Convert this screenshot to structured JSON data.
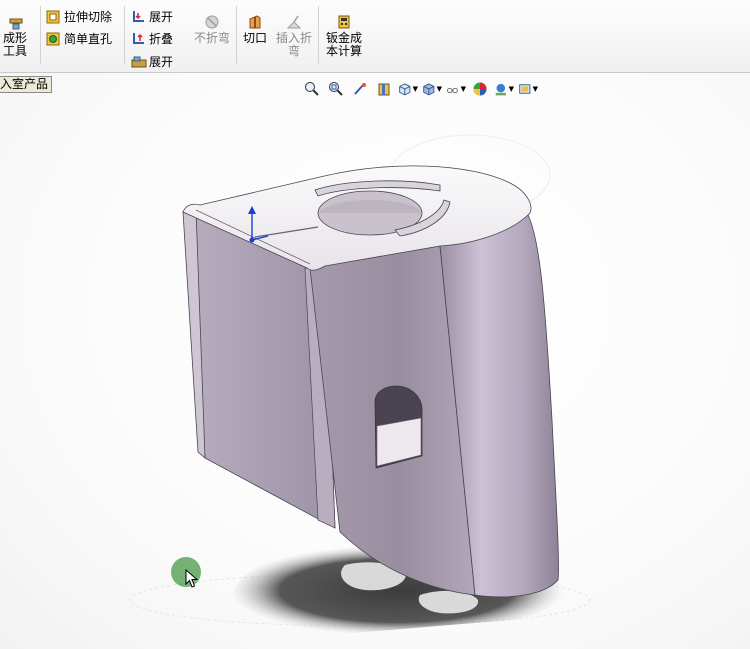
{
  "ribbon": {
    "forming_tool": "成形工具",
    "extruded_cut": "拉伸切除",
    "simple_hole": "简单直孔",
    "unfold": "展开",
    "fold": "折叠",
    "flatten": "展开",
    "no_bends": "不折弯",
    "rip": "切口",
    "insert_bends": "插入折弯",
    "sheetmetal_cost": "钣金成本计算"
  },
  "feature_tree_tab": "入室产品",
  "view_toolbar": {
    "icons": [
      "zoom-to-fit-icon",
      "zoom-to-area-icon",
      "previous-view-icon",
      "section-view-icon",
      "view-orientation-icon",
      "display-style-icon",
      "hide-show-items-icon",
      "edit-appearance-icon",
      "apply-scene-icon",
      "view-settings-icon"
    ]
  },
  "colors": {
    "model_face": "#a89cb0",
    "model_dark": "#8f8499",
    "model_light": "#e6dfea",
    "cursor_highlight": "#5ca65a"
  }
}
